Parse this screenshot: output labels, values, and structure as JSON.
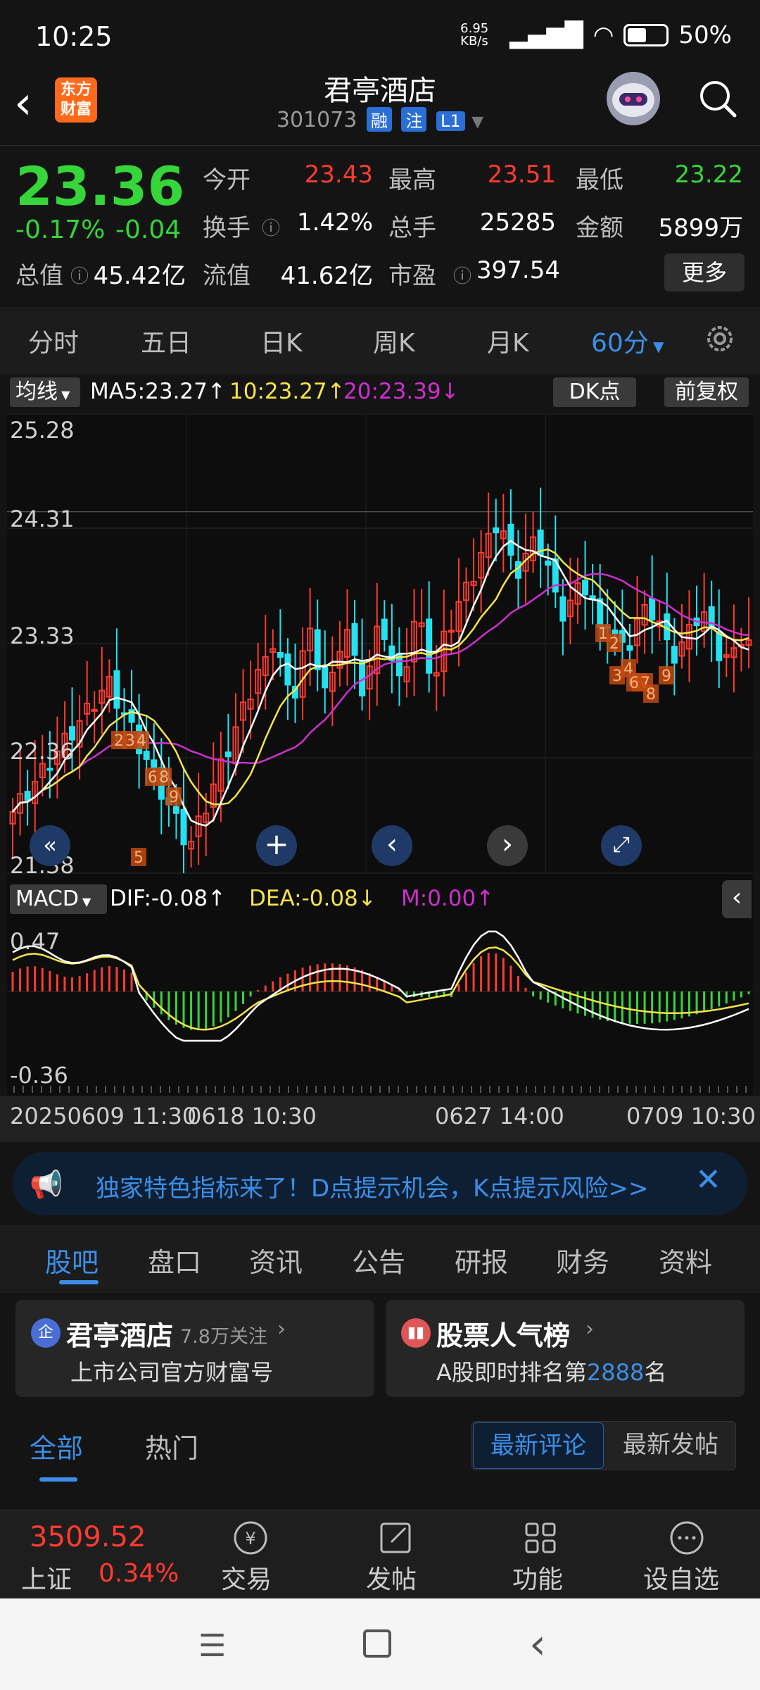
{
  "status_bar": {
    "time": "10:25",
    "net_speed": "6.95 KB/s",
    "battery": "50%"
  },
  "header": {
    "logo_text": "东方财富",
    "title": "君亭酒店",
    "code": "301073",
    "tags": [
      "融",
      "注",
      "L1"
    ]
  },
  "quote": {
    "price": "23.36",
    "change_pct": "-0.17%",
    "change": "-0.04",
    "open_label": "今开",
    "open": "23.43",
    "high_label": "最高",
    "high": "23.51",
    "low_label": "最低",
    "low": "23.22",
    "turnover_label": "换手",
    "turnover": "1.42%",
    "volume_label": "总手",
    "volume": "25285",
    "amount_label": "金额",
    "amount": "5899万",
    "mktcap_label": "总值",
    "mktcap": "45.42亿",
    "float_label": "流值",
    "float": "41.62亿",
    "pe_label": "市盈",
    "pe": "397.54",
    "more_label": "更多"
  },
  "period_tabs": [
    {
      "label": "分时"
    },
    {
      "label": "五日"
    },
    {
      "label": "日K"
    },
    {
      "label": "周K"
    },
    {
      "label": "月K"
    },
    {
      "label": "60分"
    }
  ],
  "indicators": {
    "ma_select": "均线",
    "ma5": "MA5:23.27↑",
    "ma10": "10:23.27↑",
    "ma20": "20:23.39↓",
    "dk_label": "DK点",
    "fq_label": "前复权",
    "macd_select": "MACD",
    "dif": "DIF:-0.08↑",
    "dea": "DEA:-0.08↓",
    "m": "M:0.00↑"
  },
  "chart_data": {
    "type": "candlestick",
    "price_axis_labels": [
      "25.28",
      "24.31",
      "23.33",
      "22.36",
      "21.38"
    ],
    "ylim": [
      21.38,
      25.28
    ],
    "macd_axis_labels": [
      "0.47",
      "-0.36"
    ],
    "x_labels": [
      "20250609 11:30",
      "0618 10:30",
      "0627 14:00",
      "0709 10:30"
    ],
    "ma_last": {
      "MA5": 23.27,
      "MA10": 23.27,
      "MA20": 23.39
    },
    "dk_signals_left": [
      "2",
      "3",
      "4",
      "6",
      "8",
      "9",
      "5"
    ],
    "dk_signals_right": [
      "1",
      "2",
      "3",
      "4",
      "5",
      "6",
      "7",
      "8",
      "9"
    ],
    "colors": {
      "up": "#ff3b30",
      "down": "#25e1f0",
      "ma5": "#ffffff",
      "ma10": "#f5e44b",
      "ma20": "#cf2fd0",
      "macd_pos": "#ff3b30",
      "macd_neg": "#36d53a"
    }
  },
  "marquee": {
    "text": "独家特色指标来了！D点提示机会，K点提示风险>>"
  },
  "news_tabs": [
    {
      "label": "股吧"
    },
    {
      "label": "盘口"
    },
    {
      "label": "资讯"
    },
    {
      "label": "公告"
    },
    {
      "label": "研报"
    },
    {
      "label": "财务"
    },
    {
      "label": "资料"
    }
  ],
  "cards": {
    "left_title": "君亭酒店",
    "left_follow": "7.8万关注",
    "left_sub": "上市公司官方财富号",
    "left_badge": "企",
    "right_title": "股票人气榜",
    "right_sub_pre": "A股即时排名第",
    "right_rank": "2888",
    "right_sub_post": "名"
  },
  "sub_tabs": {
    "all": "全部",
    "hot": "热门",
    "latest_comment": "最新评论",
    "latest_post": "最新发帖"
  },
  "bottom_bar": {
    "index_value": "3509.52",
    "index_name": "上证",
    "index_change": "0.34%",
    "items": [
      {
        "label": "交易"
      },
      {
        "label": "发帖"
      },
      {
        "label": "功能"
      },
      {
        "label": "设自选"
      }
    ]
  }
}
